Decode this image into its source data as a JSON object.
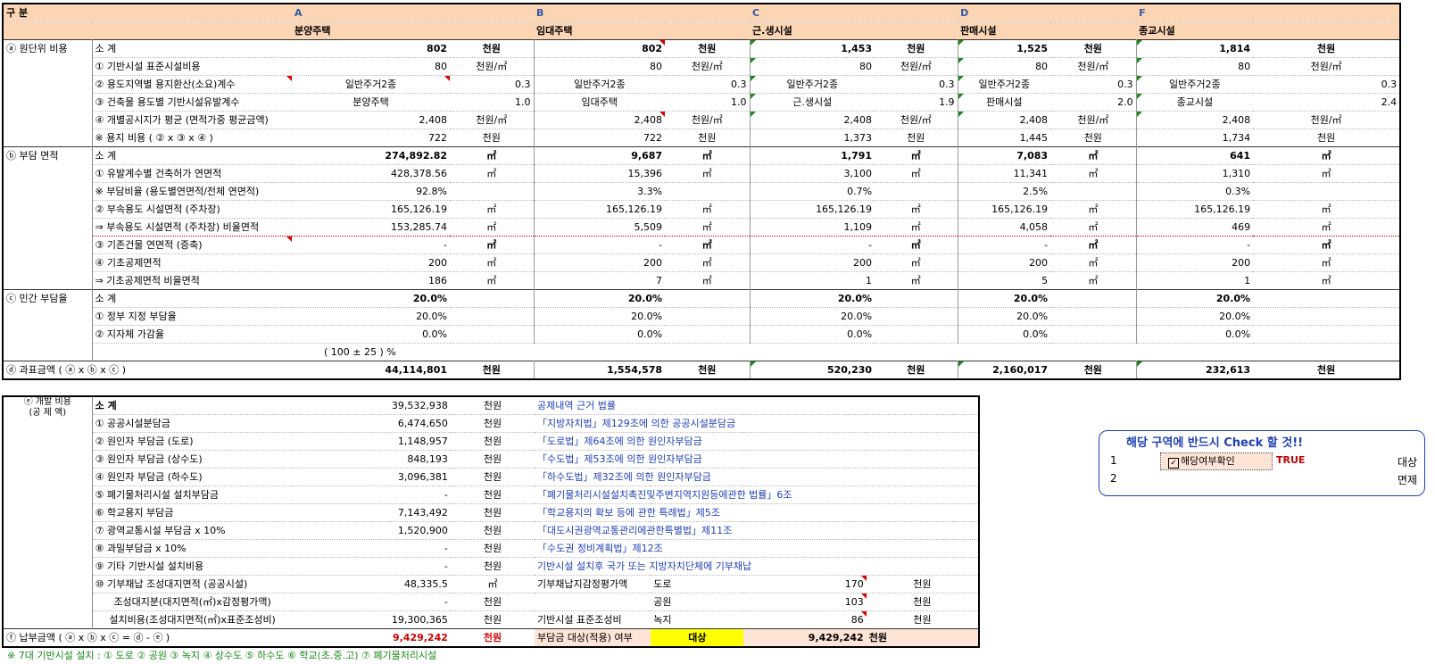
{
  "header": {
    "gubun": "구      분",
    "cols": [
      {
        "letter": "A",
        "name": "분양주택"
      },
      {
        "letter": "B",
        "name": "임대주택"
      },
      {
        "letter": "C",
        "name": "근.생시설"
      },
      {
        "letter": "D",
        "name": "판매시설"
      },
      {
        "letter": "F",
        "name": "종교시설"
      }
    ]
  },
  "unit_cost": {
    "group": "ⓐ 원단위 비용",
    "subtotal": {
      "label": "소  계",
      "vals": [
        "802",
        "802",
        "1,453",
        "1,525",
        "1,814"
      ],
      "unit": "천원"
    },
    "r1": {
      "label": "① 기반시설 표준시설비용",
      "vals": [
        "80",
        "80",
        "80",
        "80",
        "80"
      ],
      "unit": "천원/㎡"
    },
    "r2": {
      "label": "② 용도지역별 용지환산(소요)계수",
      "zones": [
        "일반주거2종",
        "일반주거2종",
        "일반주거2종",
        "일반주거2종",
        "일반주거2종"
      ],
      "vals": [
        "0.3",
        "0.3",
        "0.3",
        "0.3",
        "0.3"
      ]
    },
    "r3": {
      "label": "③ 건축물 용도별 기반시설유발계수",
      "uses": [
        "분양주택",
        "임대주택",
        "근.생시설",
        "판매시설",
        "종교시설"
      ],
      "vals": [
        "1.0",
        "1.0",
        "1.9",
        "2.0",
        "2.4"
      ]
    },
    "r4": {
      "label": "④ 개별공시지가 평균 (면적가중 평균금액)",
      "vals": [
        "2,408",
        "2,408",
        "2,408",
        "2,408",
        "2,408"
      ],
      "unit": "천원/㎡"
    },
    "r5": {
      "label": "※ 용지 비용 ( ② x ③ x ④ )",
      "vals": [
        "722",
        "722",
        "1,373",
        "1,445",
        "1,734"
      ],
      "unit": "천원"
    }
  },
  "area": {
    "group": "ⓑ 부담 면적",
    "subtotal": {
      "label": "소  계",
      "vals": [
        "274,892.82",
        "9,687",
        "1,791",
        "7,083",
        "641"
      ],
      "unit": "㎡"
    },
    "r1": {
      "label": "① 유발계수별 건축허가 연면적",
      "vals": [
        "428,378.56",
        "15,396",
        "3,100",
        "11,341",
        "1,310"
      ],
      "unit": "㎡"
    },
    "r2": {
      "label": "※ 부담비율 (용도별연면적/전체 연면적)",
      "vals": [
        "92.8%",
        "3.3%",
        "0.7%",
        "2.5%",
        "0.3%"
      ]
    },
    "r3": {
      "label": "② 부속용도 시설면적 (주차장)",
      "vals": [
        "165,126.19",
        "165,126.19",
        "165,126.19",
        "165,126.19",
        "165,126.19"
      ],
      "unit": "㎡"
    },
    "r4": {
      "label": "  ⇒ 부속용도 시설면적 (주차장) 비율면적",
      "vals": [
        "153,285.74",
        "5,509",
        "1,109",
        "4,058",
        "469"
      ],
      "unit": "㎡"
    },
    "r5": {
      "label": "③ 기존건물 연면적 (증축)",
      "vals": [
        "-",
        "-",
        "-",
        "-",
        "-"
      ],
      "unit": "㎡"
    },
    "r6": {
      "label": "④ 기초공제면적",
      "vals": [
        "200",
        "200",
        "200",
        "200",
        "200"
      ],
      "unit": "㎡"
    },
    "r7": {
      "label": "  ⇒ 기초공제면적 비율면적",
      "vals": [
        "186",
        "7",
        "1",
        "5",
        "1"
      ],
      "unit": "㎡"
    }
  },
  "burden": {
    "group": "ⓒ 민간 부담율",
    "subtotal": {
      "label": "소  계",
      "vals": [
        "20.0%",
        "20.0%",
        "20.0%",
        "20.0%",
        "20.0%"
      ]
    },
    "r1": {
      "label": "① 정부 지정 부담율",
      "vals": [
        "20.0%",
        "20.0%",
        "20.0%",
        "20.0%",
        "20.0%"
      ]
    },
    "r2": {
      "label": "② 지자체 가감율",
      "vals": [
        "0.0%",
        "0.0%",
        "0.0%",
        "0.0%",
        "0.0%"
      ]
    },
    "note": "( 100 ± 25 ) %"
  },
  "tax": {
    "label": "ⓓ 과표금액 ( ⓐ x ⓑ x ⓒ )",
    "vals": [
      "44,114,801",
      "1,554,578",
      "520,230",
      "2,160,017",
      "232,613"
    ],
    "unit": "천원"
  },
  "dev": {
    "group": "ⓔ 개발 비용",
    "group2": "(공 제 액)",
    "rows": [
      {
        "label": "소  계",
        "val": "39,532,938",
        "unit": "천원",
        "law": "공제내역 근거 법률"
      },
      {
        "label": "① 공공시설분담금",
        "val": "6,474,650",
        "unit": "천원",
        "law": "「지방자치법」제129조에 의한 공공시설분담금"
      },
      {
        "label": "② 원인자 부담금 (도로)",
        "val": "1,148,957",
        "unit": "천원",
        "law": "「도로법」제64조에 의한 원인자부담금"
      },
      {
        "label": "③ 원인자 부담금 (상수도)",
        "val": "848,193",
        "unit": "천원",
        "law": "「수도법」제53조에 의한 원인자부담금"
      },
      {
        "label": "④ 원인자 부담금 (하수도)",
        "val": "3,096,381",
        "unit": "천원",
        "law": "「하수도법」제32조에 의한 원인자부담금"
      },
      {
        "label": "⑤ 폐기물처리시설 설치부담금",
        "val": "-",
        "unit": "천원",
        "law": "「폐기물처리시설설치촉진및주변지역지원등에관한 법률」6조"
      },
      {
        "label": "⑥ 학교용지 부담금",
        "val": "7,143,492",
        "unit": "천원",
        "law": "「학교용지의 확보 등에 관한 특례법」제5조"
      },
      {
        "label": "⑦ 광역교통시설 부담금 x 10%",
        "val": "1,520,900",
        "unit": "천원",
        "law": "「대도시권광역교통관리에관한특별법」제11조"
      },
      {
        "label": "⑧ 과밀부담금 x 10%",
        "val": "-",
        "unit": "천원",
        "law": "「수도권 정비계획법」제12조"
      },
      {
        "label": "⑨ 기타 기반시설 설치비용",
        "val": "-",
        "unit": "천원",
        "law": "기반시설 설치후 국가 또는 지방자치단체에 기부채납"
      }
    ],
    "r10": {
      "label": "⑩ 기부채납 조성대지면적 (공공시설)",
      "val": "48,335.5",
      "unit": "㎡",
      "desc": "기부채납지감정평가액",
      "item": "도로",
      "ival": "170",
      "iunit": "천원"
    },
    "r11": {
      "label": "조성대지분(대지면적(㎡)x감정평가액)",
      "val": "-",
      "unit": "천원",
      "item": "공원",
      "ival": "103",
      "iunit": "천원"
    },
    "r12": {
      "label": "설치비용(조성대지면적(㎡)x표준조성비)",
      "val": "19,300,365",
      "unit": "천원",
      "desc": "기반시설 표준조성비",
      "item": "녹지",
      "ival": "86",
      "iunit": "천원"
    }
  },
  "pay": {
    "label": "ⓕ 납부금액 ( ⓐ x ⓑ x ⓒ = ⓓ - ⓔ )",
    "val": "9,429,242",
    "unit": "천원",
    "q": "부담금 대상(적용) 여부",
    "status": "대상",
    "total": "9,429,242",
    "tunit": "천원"
  },
  "footnote": "※ 7대 기반시설 설치 : ① 도로 ② 공원 ③ 녹지 ④ 상수도 ⑤ 하수도 ⑥ 학교(초.중.고) ⑦ 폐기물처리시설",
  "check": {
    "title": "해당 구역에 반드시 Check 할 것!!",
    "row1_no": "1",
    "row1_label": "해당여부확인",
    "row1_value": "TRUE",
    "row1_right": "대상",
    "row2_no": "2",
    "row2_right": "면제"
  },
  "colors": {
    "header_bg": "#fcd5b4",
    "highlight": "#ffff00",
    "total_red": "#d00000"
  }
}
